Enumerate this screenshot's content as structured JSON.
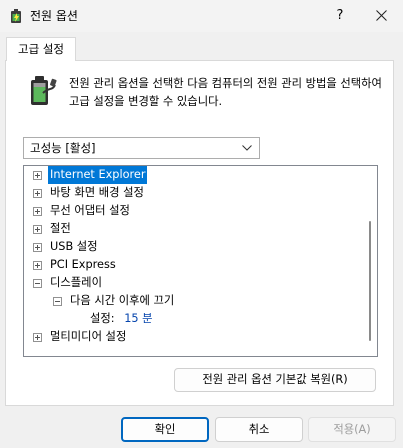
{
  "window": {
    "title": "전원 옵션",
    "help_label": "?",
    "icon": "battery-plug-icon"
  },
  "tab": {
    "label": "고급 설정"
  },
  "description": "전원 관리 옵션을 선택한 다음 컴퓨터의 전원 관리 방법을 선택하여 고급 설정을 변경할 수 있습니다.",
  "plan_select": {
    "value": "고성능 [활성]"
  },
  "tree": {
    "items": [
      {
        "label": "Internet Explorer",
        "expander": "+",
        "selected": true
      },
      {
        "label": "바탕 화면 배경 설정",
        "expander": "+"
      },
      {
        "label": "무선 어댑터 설정",
        "expander": "+"
      },
      {
        "label": "절전",
        "expander": "+"
      },
      {
        "label": "USB 설정",
        "expander": "+"
      },
      {
        "label": "PCI Express",
        "expander": "+"
      },
      {
        "label": "디스플레이",
        "expander": "-"
      },
      {
        "label": "다음 시간 이후에 끄기",
        "expander": "-"
      },
      {
        "label": "설정:",
        "value": "15 분"
      },
      {
        "label": "멀티미디어 설정",
        "expander": "+"
      }
    ]
  },
  "buttons": {
    "restore": "전원 관리 옵션 기본값 복원(R)",
    "ok": "확인",
    "cancel": "취소",
    "apply": "적용(A)"
  },
  "colors": {
    "accent": "#0078d7",
    "value_blue": "#0645ad"
  }
}
